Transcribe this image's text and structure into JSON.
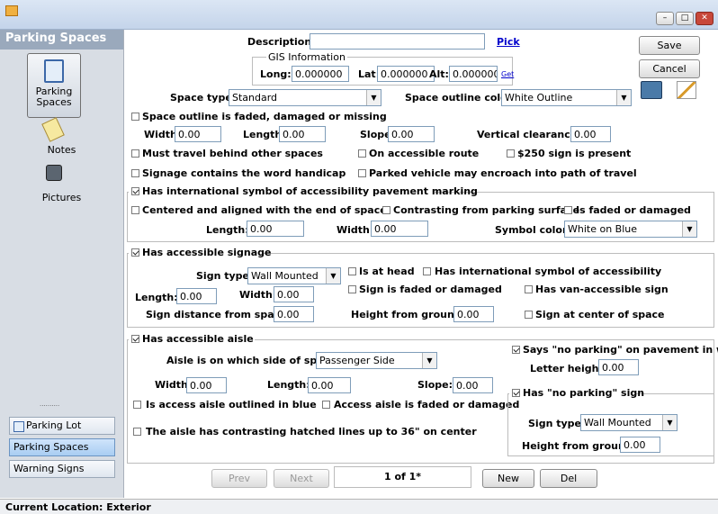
{
  "window": {
    "min": "–",
    "max": "□",
    "close": "✕"
  },
  "sidebar": {
    "title": "Parking Spaces",
    "icons": [
      {
        "label": "Parking Spaces",
        "icon": "clipboard-check-icon"
      },
      {
        "label": "Notes",
        "icon": "notepad-icon"
      },
      {
        "label": "Pictures",
        "icon": "camera-icon"
      }
    ],
    "dots": "..........",
    "nav": [
      {
        "label": "Parking Lot"
      },
      {
        "label": "Parking Spaces"
      },
      {
        "label": "Warning Signs"
      }
    ]
  },
  "form": {
    "description_label": "Description:",
    "description_value": "",
    "pick": "Pick",
    "gis_title": "GIS Information",
    "long_label": "Long:",
    "long_value": "0.000000",
    "lat_label": "Lat:",
    "lat_value": "0.000000",
    "alt_label": "Alt:",
    "alt_value": "0.000000",
    "get": "Get",
    "save": "Save",
    "cancel": "Cancel",
    "space_type_label": "Space type:",
    "space_type_value": "Standard",
    "outline_color_label": "Space outline color:",
    "outline_color_value": "White Outline",
    "outline_faded": "Space outline is faded, damaged or missing",
    "width_label": "Width:",
    "width_value": "0.00",
    "length_label": "Length:",
    "length_value": "0.00",
    "slope_label": "Slope:",
    "slope_value": "0.00",
    "vclear_label": "Vertical clearance:",
    "vclear_value": "0.00",
    "behind": "Must travel behind other spaces",
    "on_route": "On accessible route",
    "sign250": "$250 sign is present",
    "handicap": "Signage contains the word handicap",
    "encroach": "Parked vehicle may encroach into path of travel",
    "intl_marking": "Has international symbol of accessibility pavement marking",
    "centered": "Centered and aligned with the end of space",
    "contrasting": "Contrasting from parking surface",
    "sym_faded": "Is faded or damaged",
    "sym_length_label": "Length:",
    "sym_length_value": "0.00",
    "sym_width_label": "Width:",
    "sym_width_value": "0.00",
    "sym_color_label": "Symbol color:",
    "sym_color_value": "White on Blue",
    "has_signage": "Has accessible signage",
    "sign_type_label": "Sign type:",
    "sign_type_value": "Wall Mounted",
    "at_head": "Is at head",
    "has_intl": "Has international symbol of accessibility",
    "sign_length_label": "Length:",
    "sign_length_value": "0.00",
    "sign_width_label": "Width:",
    "sign_width_value": "0.00",
    "sign_faded": "Sign is faded or damaged",
    "van_sign": "Has van-accessible sign",
    "sign_dist_label": "Sign distance from space:",
    "sign_dist_value": "0.00",
    "sign_height_label": "Height from ground:",
    "sign_height_value": "0.00",
    "sign_center": "Sign at center of space",
    "has_aisle": "Has accessible aisle",
    "aisle_side_label": "Aisle is on which side of space:",
    "aisle_side_value": "Passenger Side",
    "aisle_width_label": "Width:",
    "aisle_width_value": "0.00",
    "aisle_length_label": "Length:",
    "aisle_length_value": "0.00",
    "aisle_slope_label": "Slope:",
    "aisle_slope_value": "0.00",
    "aisle_blue": "Is access aisle outlined in blue",
    "aisle_faded": "Access aisle is faded or damaged",
    "aisle_hatched": "The aisle has contrasting hatched lines up to 36\" on center",
    "says_noparking": "Says \"no parking\" on pavement in white",
    "letter_label": "Letter height:",
    "letter_value": "0.00",
    "noparking_sign": "Has \"no parking\" sign",
    "np_type_label": "Sign type:",
    "np_type_value": "Wall Mounted",
    "np_height_label": "Height from ground:",
    "np_height_value": "0.00"
  },
  "pager": {
    "prev": "Prev",
    "next": "Next",
    "page": "1 of 1*",
    "new": "New",
    "del": "Del"
  },
  "status": "Current Location: Exterior"
}
